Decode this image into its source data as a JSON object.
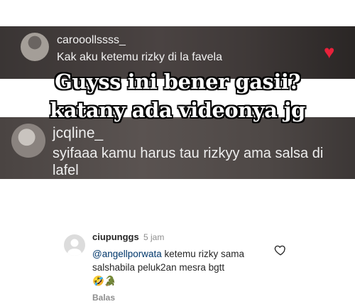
{
  "comment1": {
    "username": "carooollssss_",
    "text": "Kak aku ketemu rizky di la favela",
    "heart": "♥"
  },
  "caption": {
    "line1": "Guyss ini bener gasii?",
    "line2": "katany ada videonya jg"
  },
  "comment2": {
    "username": "jcqline_",
    "text": "syifaaa kamu harus tau rizkyy ama salsa di lafel"
  },
  "comment3": {
    "username": "ciupunggs",
    "time": "5 jam",
    "mention": "@angellporwata",
    "text": " ketemu rizky sama salshabila peluk2an mesra bgtt",
    "emoji": "🤣🐊",
    "reply_label": "Balas"
  },
  "colors": {
    "heart_red": "#e8213a",
    "mention_blue": "#00376b",
    "muted_gray": "#8e8e8e"
  }
}
